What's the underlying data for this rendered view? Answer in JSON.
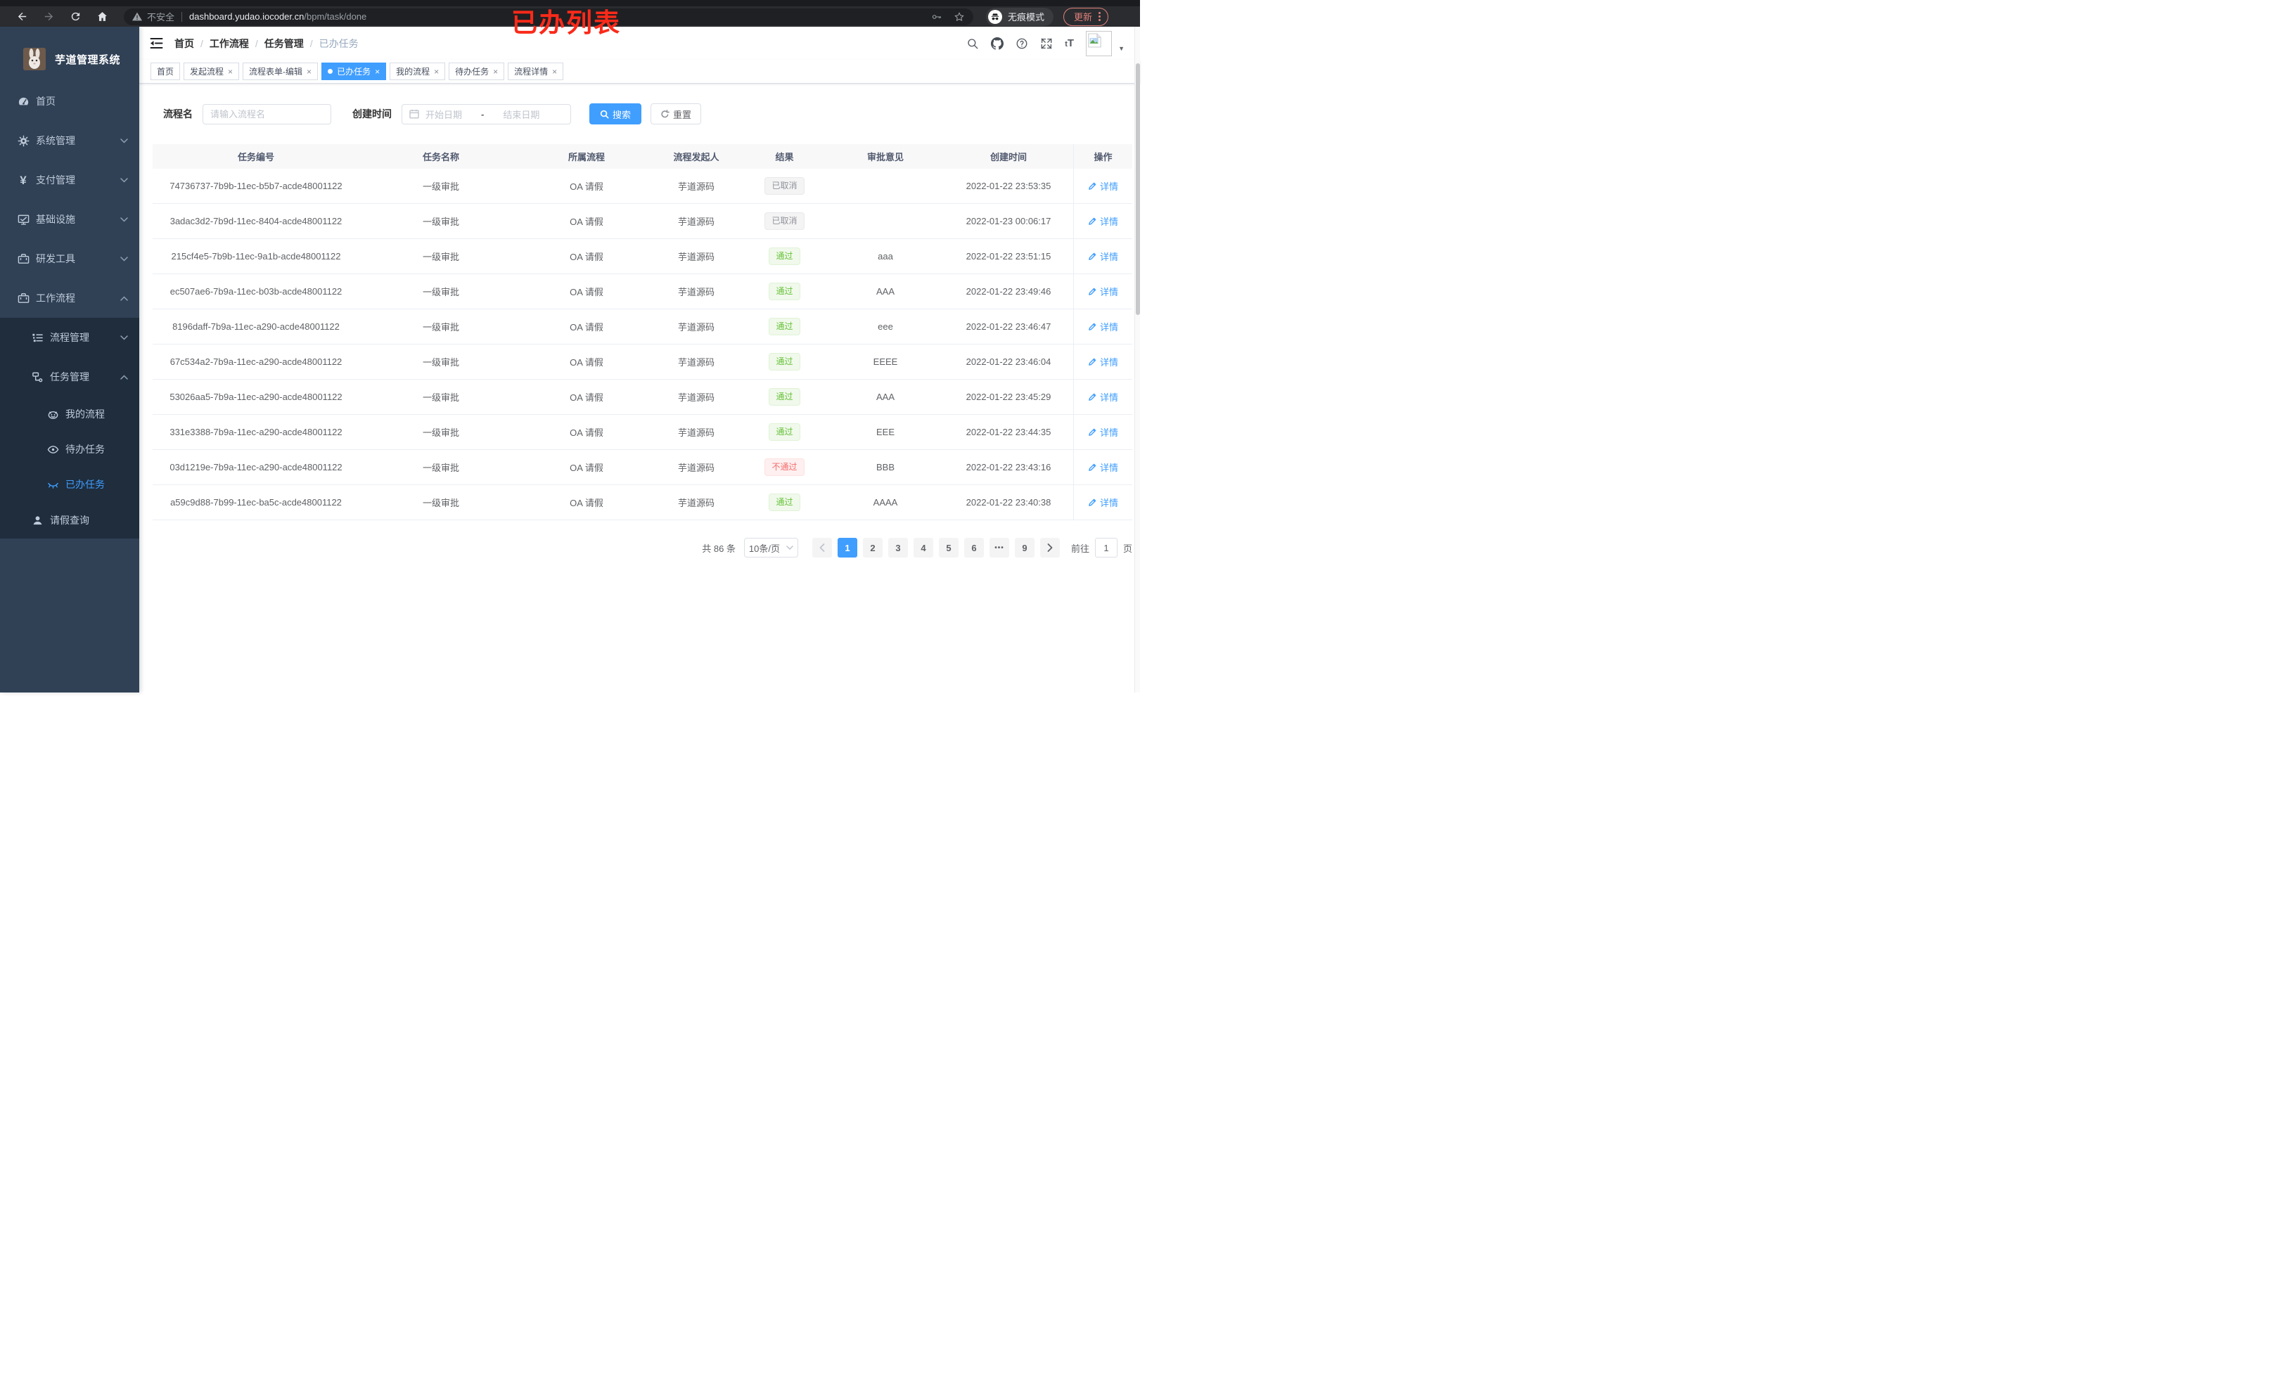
{
  "colors": {
    "accent": "#409eff",
    "sidebar_bg": "#304156",
    "submenu_bg": "#1f2d3d",
    "annotation_red": "#fa2a1a",
    "success": "#67c23a",
    "danger": "#f56c6c",
    "info": "#909399"
  },
  "annotation": {
    "text": "已办列表"
  },
  "browser": {
    "security_label": "不安全",
    "url_host": "dashboard.yudao.iocoder.cn",
    "url_path": "/bpm/task/done",
    "incognito_label": "无痕模式",
    "update_label": "更新"
  },
  "sidebar": {
    "title": "芋道管理系统",
    "items": [
      {
        "label": "首页"
      },
      {
        "label": "系统管理"
      },
      {
        "label": "支付管理"
      },
      {
        "label": "基础设施"
      },
      {
        "label": "研发工具"
      },
      {
        "label": "工作流程"
      },
      {
        "label": "流程管理"
      },
      {
        "label": "任务管理"
      },
      {
        "label": "我的流程"
      },
      {
        "label": "待办任务"
      },
      {
        "label": "已办任务"
      },
      {
        "label": "请假查询"
      }
    ],
    "yen_glyph": "¥"
  },
  "header": {
    "breadcrumb": [
      "首页",
      "工作流程",
      "任务管理",
      "已办任务"
    ],
    "separator": "/",
    "font_size_glyph_small": "t",
    "font_size_glyph_big": "T",
    "caret_glyph": "▼"
  },
  "tabs": {
    "close_glyph": "×",
    "items": [
      {
        "label": "首页"
      },
      {
        "label": "发起流程"
      },
      {
        "label": "流程表单-编辑"
      },
      {
        "label": "已办任务",
        "active": true
      },
      {
        "label": "我的流程"
      },
      {
        "label": "待办任务"
      },
      {
        "label": "流程详情"
      }
    ]
  },
  "filters": {
    "name_label": "流程名",
    "name_placeholder": "请输入流程名",
    "date_label": "创建时间",
    "date_start_placeholder": "开始日期",
    "date_separator": "-",
    "date_end_placeholder": "结束日期",
    "search_label": "搜索",
    "reset_label": "重置"
  },
  "table": {
    "columns": [
      "任务编号",
      "任务名称",
      "所属流程",
      "流程发起人",
      "结果",
      "审批意见",
      "创建时间",
      "操作"
    ],
    "action_label": "详情",
    "rows": [
      {
        "id": "74736737-7b9b-11ec-b5b7-acde48001122",
        "name": "一级审批",
        "process": "OA 请假",
        "initiator": "芋道源码",
        "result": "已取消",
        "result_type": "info",
        "comment": "",
        "created": "2022-01-22 23:53:35"
      },
      {
        "id": "3adac3d2-7b9d-11ec-8404-acde48001122",
        "name": "一级审批",
        "process": "OA 请假",
        "initiator": "芋道源码",
        "result": "已取消",
        "result_type": "info",
        "comment": "",
        "created": "2022-01-23 00:06:17"
      },
      {
        "id": "215cf4e5-7b9b-11ec-9a1b-acde48001122",
        "name": "一级审批",
        "process": "OA 请假",
        "initiator": "芋道源码",
        "result": "通过",
        "result_type": "success",
        "comment": "aaa",
        "created": "2022-01-22 23:51:15"
      },
      {
        "id": "ec507ae6-7b9a-11ec-b03b-acde48001122",
        "name": "一级审批",
        "process": "OA 请假",
        "initiator": "芋道源码",
        "result": "通过",
        "result_type": "success",
        "comment": "AAA",
        "created": "2022-01-22 23:49:46"
      },
      {
        "id": "8196daff-7b9a-11ec-a290-acde48001122",
        "name": "一级审批",
        "process": "OA 请假",
        "initiator": "芋道源码",
        "result": "通过",
        "result_type": "success",
        "comment": "eee",
        "created": "2022-01-22 23:46:47"
      },
      {
        "id": "67c534a2-7b9a-11ec-a290-acde48001122",
        "name": "一级审批",
        "process": "OA 请假",
        "initiator": "芋道源码",
        "result": "通过",
        "result_type": "success",
        "comment": "EEEE",
        "created": "2022-01-22 23:46:04"
      },
      {
        "id": "53026aa5-7b9a-11ec-a290-acde48001122",
        "name": "一级审批",
        "process": "OA 请假",
        "initiator": "芋道源码",
        "result": "通过",
        "result_type": "success",
        "comment": "AAA",
        "created": "2022-01-22 23:45:29"
      },
      {
        "id": "331e3388-7b9a-11ec-a290-acde48001122",
        "name": "一级审批",
        "process": "OA 请假",
        "initiator": "芋道源码",
        "result": "通过",
        "result_type": "success",
        "comment": "EEE",
        "created": "2022-01-22 23:44:35"
      },
      {
        "id": "03d1219e-7b9a-11ec-a290-acde48001122",
        "name": "一级审批",
        "process": "OA 请假",
        "initiator": "芋道源码",
        "result": "不通过",
        "result_type": "danger",
        "comment": "BBB",
        "created": "2022-01-22 23:43:16"
      },
      {
        "id": "a59c9d88-7b99-11ec-ba5c-acde48001122",
        "name": "一级审批",
        "process": "OA 请假",
        "initiator": "芋道源码",
        "result": "通过",
        "result_type": "success",
        "comment": "AAAA",
        "created": "2022-01-22 23:40:38"
      }
    ]
  },
  "pagination": {
    "total_label": "共 86 条",
    "page_size": "10条/页",
    "pages": [
      "1",
      "2",
      "3",
      "4",
      "5",
      "6",
      "•••",
      "9"
    ],
    "active_page": "1",
    "goto_label": "前往",
    "goto_value": "1",
    "page_suffix": "页"
  }
}
